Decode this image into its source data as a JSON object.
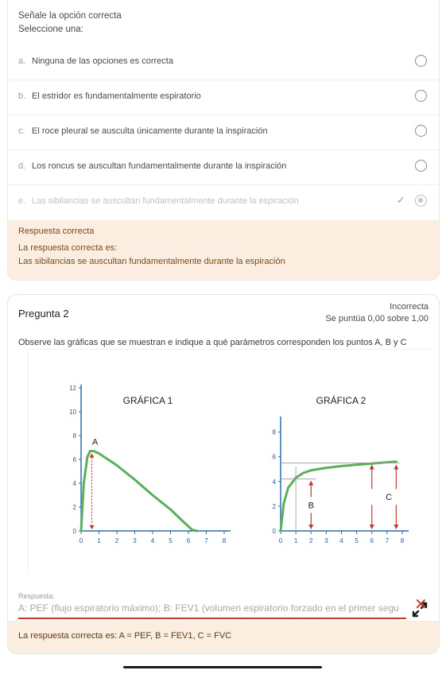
{
  "question1": {
    "instruction": "Señale la opción correcta",
    "select_one": "Seleccione una:",
    "options": [
      {
        "letter": "a.",
        "text": "Ninguna de las opciones es correcta"
      },
      {
        "letter": "b.",
        "text": "El estridor es fundamentalmente espiratorio"
      },
      {
        "letter": "c.",
        "text": "El roce pleural se ausculta únicamente durante la inspiración"
      },
      {
        "letter": "d.",
        "text": "Los roncus se auscultan fundamentalmente durante la inspiración"
      },
      {
        "letter": "e.",
        "text": "Las sibilancias se auscultan fundamentalmente durante la espiración"
      }
    ],
    "selected_option": "e.",
    "feedback": {
      "result": "Respuesta correcta",
      "intro": "La respuesta correcta es:",
      "answer": "Las sibilancias se auscultan fundamentalmente durante la espiración"
    }
  },
  "question2": {
    "title": "Pregunta 2",
    "status": "Incorrecta",
    "score": "Se puntúa 0,00 sobre 1,00",
    "text": "Observe las gráficas que se muestran e indique a qué parámetros corresponden los puntos A, B y C",
    "answer_label": "Respuesta:",
    "answer_value": "A: PEF (flujo espiratorio máximo); B: FEV1 (volumen espiratorio forzado en el primer segu",
    "correct_answer": "La respuesta correcta es: A = PEF, B = FEV1, C = FVC",
    "accent_error": "#c0392b",
    "feedback_bg": "#fbeee0"
  },
  "chart_data": [
    {
      "type": "line",
      "title": "GRÁFICA 1",
      "x_ticks": [
        "0",
        "1",
        "2",
        "3",
        "4",
        "5",
        "6",
        "7",
        "8"
      ],
      "y_ticks": [
        "0",
        "2",
        "4",
        "6",
        "8",
        "10",
        "12"
      ],
      "xlim": [
        0,
        8
      ],
      "ylim": [
        0,
        12
      ],
      "series": [
        {
          "x": [
            0,
            0.15,
            0.35,
            0.5,
            0.7,
            1,
            2,
            3,
            4,
            5,
            5.7,
            6.2,
            6.5
          ],
          "y": [
            0,
            4,
            6.2,
            6.7,
            6.7,
            6.5,
            5.5,
            4.3,
            3.0,
            1.8,
            0.8,
            0.1,
            0
          ]
        }
      ],
      "annotations": [
        {
          "label": "A",
          "x": 0.6,
          "y": 6.7
        }
      ],
      "color": "#5aaf5a"
    },
    {
      "type": "line",
      "title": "GRÁFICA 2",
      "x_ticks": [
        "0",
        "1",
        "2",
        "3",
        "4",
        "5",
        "6",
        "7",
        "8"
      ],
      "y_ticks": [
        "0",
        "2",
        "4",
        "6",
        "8"
      ],
      "xlim": [
        0,
        8
      ],
      "ylim": [
        0,
        9
      ],
      "series": [
        {
          "x": [
            0,
            0.2,
            0.5,
            1,
            1.5,
            2,
            3,
            4,
            5,
            6,
            7,
            7.6
          ],
          "y": [
            0,
            2.2,
            3.5,
            4.3,
            4.7,
            4.9,
            5.1,
            5.25,
            5.35,
            5.45,
            5.55,
            5.6
          ]
        }
      ],
      "annotations": [
        {
          "label": "B",
          "x": 2,
          "y": 4.2
        },
        {
          "label": "C",
          "x": 6,
          "y": 5.5
        }
      ],
      "color": "#5aaf5a"
    }
  ]
}
